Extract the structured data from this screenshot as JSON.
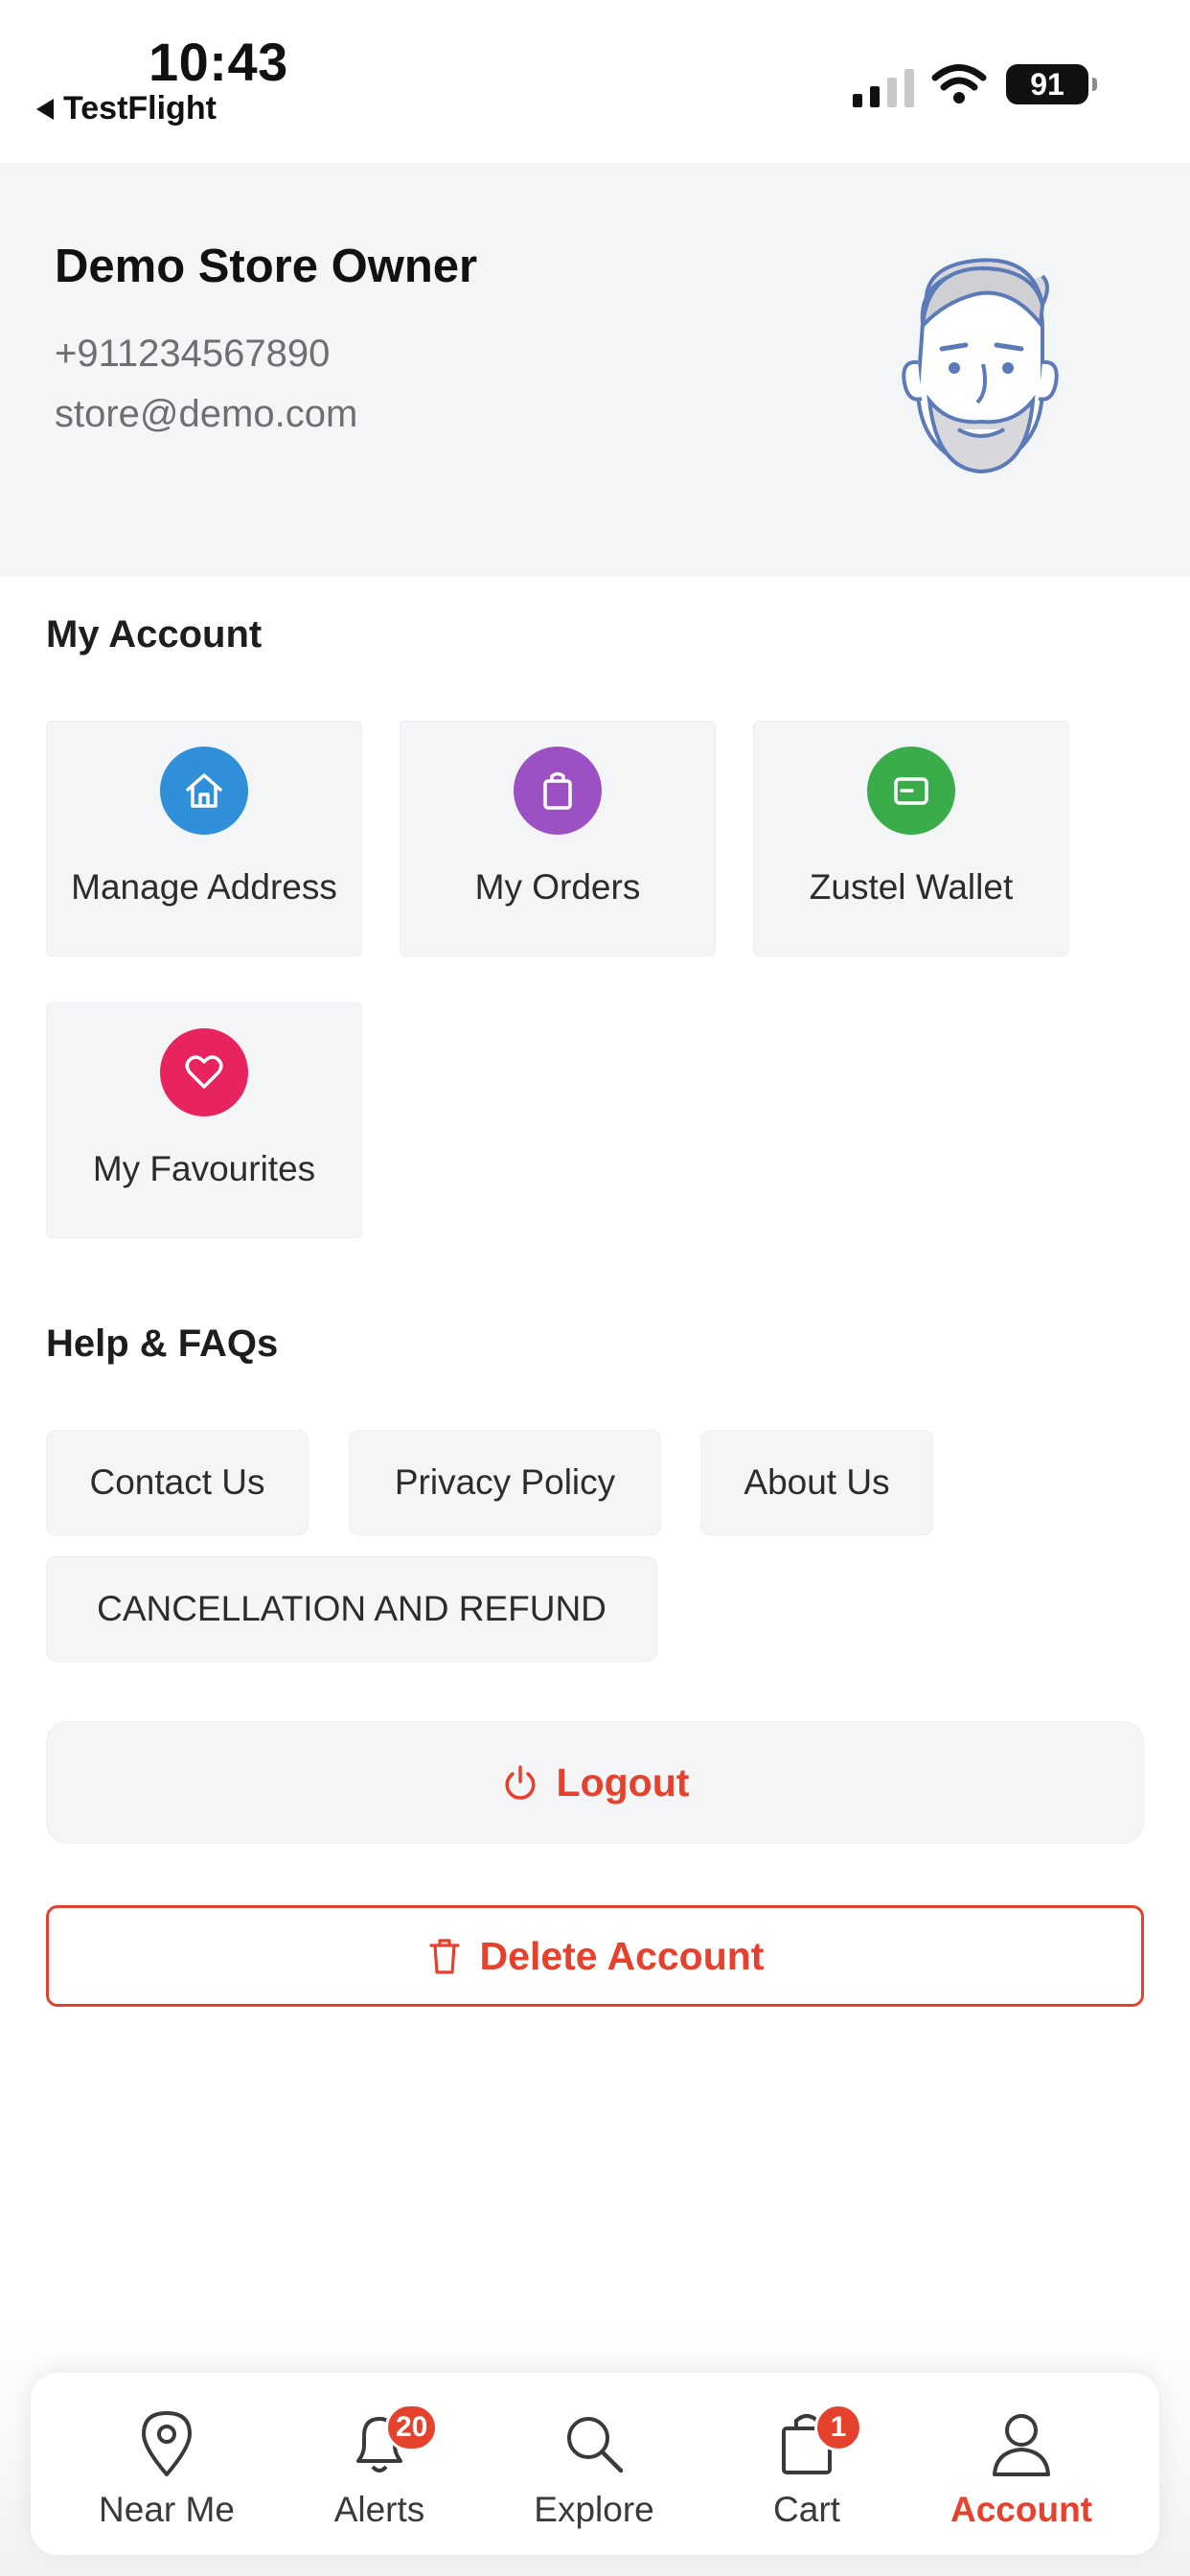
{
  "status_bar": {
    "time": "10:43",
    "back_app": "TestFlight",
    "battery": "91"
  },
  "profile": {
    "name": "Demo Store Owner",
    "phone": "+911234567890",
    "email": "store@demo.com",
    "avatar_icon": "avatar-illustration"
  },
  "my_account": {
    "title": "My Account",
    "tiles": [
      {
        "label": "Manage Address",
        "icon": "home-icon",
        "color": "#2f8fd8"
      },
      {
        "label": "My Orders",
        "icon": "bag-icon",
        "color": "#9b51c4"
      },
      {
        "label": "Zustel Wallet",
        "icon": "wallet-icon",
        "color": "#3aac4a"
      },
      {
        "label": "My Favourites",
        "icon": "heart-icon",
        "color": "#e8245f"
      }
    ]
  },
  "help": {
    "title": "Help & FAQs",
    "chips": [
      {
        "label": "Contact Us"
      },
      {
        "label": "Privacy Policy"
      },
      {
        "label": "About Us"
      },
      {
        "label": "CANCELLATION AND REFUND"
      }
    ]
  },
  "actions": {
    "logout": "Logout",
    "delete_account": "Delete Account",
    "accent_color": "#e5412d"
  },
  "bottom_nav": {
    "items": [
      {
        "label": "Near Me",
        "icon": "location-pin-icon"
      },
      {
        "label": "Alerts",
        "icon": "bell-icon",
        "badge": "20"
      },
      {
        "label": "Explore",
        "icon": "search-icon"
      },
      {
        "label": "Cart",
        "icon": "shopping-bag-icon",
        "badge": "1"
      },
      {
        "label": "Account",
        "icon": "user-icon",
        "active": true
      }
    ]
  }
}
